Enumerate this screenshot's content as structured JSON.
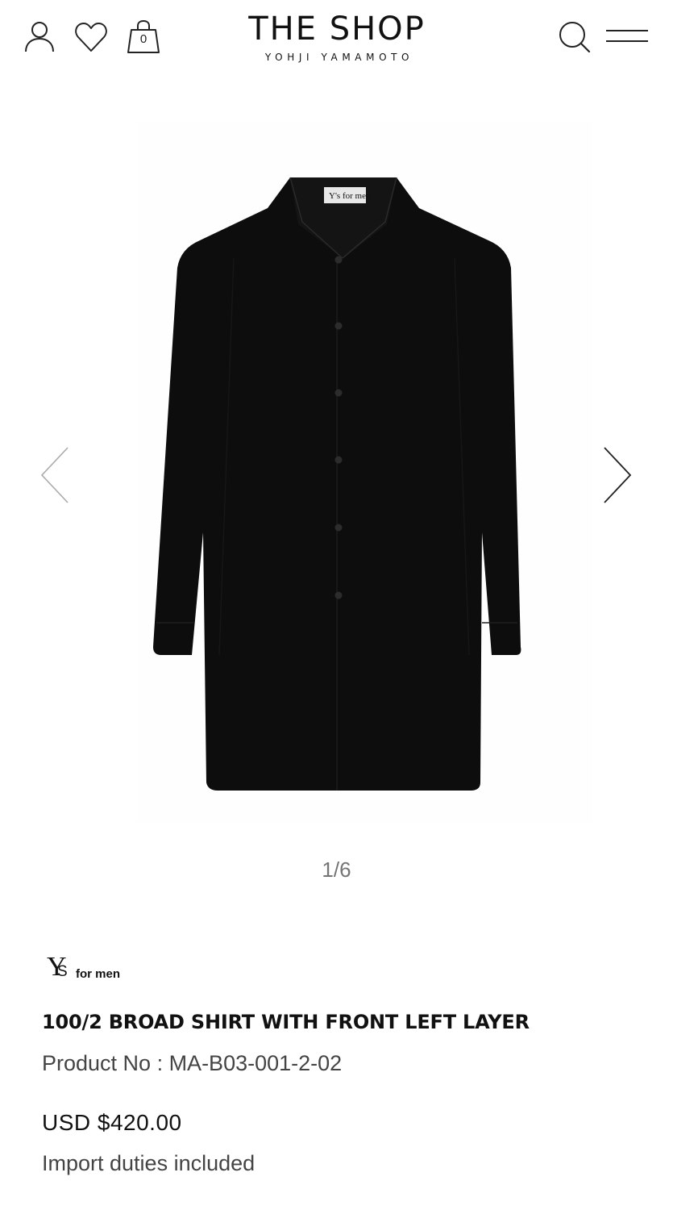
{
  "header": {
    "logo_title": "THE SHOP",
    "logo_subtitle": "YOHJI YAMAMOTO",
    "cart_count": "0",
    "icons": {
      "account": "account-icon",
      "wishlist": "heart-icon",
      "cart": "shopping-bag-icon",
      "search": "search-icon",
      "menu": "hamburger-menu-icon"
    }
  },
  "gallery": {
    "counter": "1/6",
    "current_image": 1,
    "total_images": 6,
    "prev_icon": "chevron-left-icon",
    "next_icon": "chevron-right-icon"
  },
  "product": {
    "brand": {
      "y": "Y",
      "s": "S",
      "for_men": "for men"
    },
    "name": "100/2 BROAD SHIRT WITH FRONT LEFT LAYER",
    "product_no": "Product No : MA-B03-001-2-02",
    "price": "USD $420.00",
    "duties_note": "Import duties included",
    "label_text": "Y's for men"
  },
  "colors": {
    "background": "#ffffff",
    "text": "#111111",
    "muted_text": "#444444",
    "counter_text": "#757575",
    "shirt": "#0d0d0d"
  }
}
